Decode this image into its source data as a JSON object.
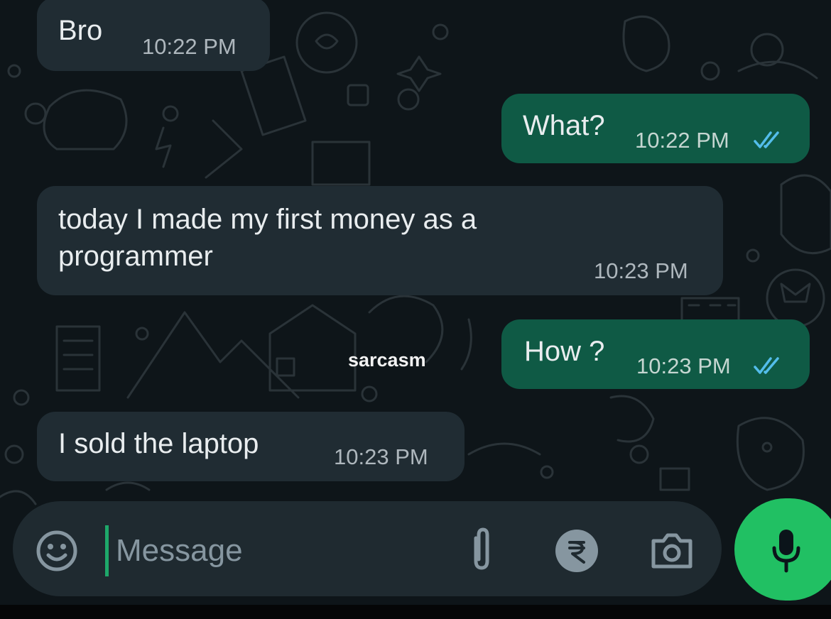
{
  "messages": [
    {
      "direction": "incoming",
      "text": "Bro",
      "time": "10:22 PM"
    },
    {
      "direction": "outgoing",
      "text": "What?",
      "time": "10:22 PM",
      "status": "double-check-icon"
    },
    {
      "direction": "incoming",
      "text_line1": "today I made my first money as a",
      "text_line2": "programmer",
      "time": "10:23 PM"
    },
    {
      "direction": "outgoing",
      "text": "How ?",
      "time": "10:23 PM",
      "status": "double-check-icon"
    },
    {
      "direction": "incoming",
      "text": "I sold the laptop",
      "time": "10:23 PM"
    }
  ],
  "watermark": "sarcasm",
  "composer": {
    "placeholder": "Message",
    "icons": [
      "emoji-icon",
      "attach-icon",
      "rupee-payment-icon",
      "camera-icon",
      "microphone-icon"
    ]
  },
  "colors": {
    "incoming_bubble": "#202c33",
    "outgoing_bubble": "#0f5a45",
    "read_ticks": "#53bdeb",
    "mic_button": "#21c063"
  }
}
